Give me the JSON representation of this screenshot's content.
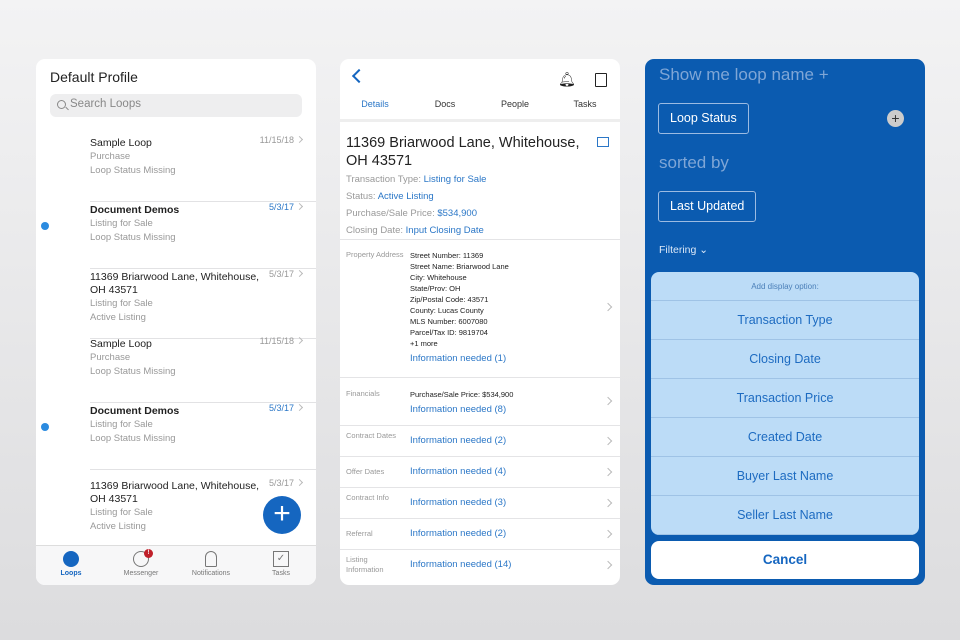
{
  "left": {
    "title": "Default Profile",
    "search_placeholder": "Search Loops",
    "loops": [
      {
        "title": "Sample Loop",
        "type": "Purchase",
        "status": "Loop Status Missing",
        "date": "11/15/18",
        "unread": false
      },
      {
        "title": "Document Demos",
        "type": "Listing for Sale",
        "status": "Loop Status Missing",
        "date": "5/3/17",
        "unread": true
      },
      {
        "title": "11369 Briarwood Lane, Whitehouse, OH 43571",
        "type": "Listing for Sale",
        "status": "Active Listing",
        "date": "5/3/17",
        "unread": false
      },
      {
        "title": "Sample Loop",
        "type": "Purchase",
        "status": "Loop Status Missing",
        "date": "11/15/18",
        "unread": false
      },
      {
        "title": "Document Demos",
        "type": "Listing for Sale",
        "status": "Loop Status Missing",
        "date": "5/3/17",
        "unread": true
      },
      {
        "title": "11369 Briarwood Lane, Whitehouse, OH 43571",
        "type": "Listing for Sale",
        "status": "Active Listing",
        "date": "5/3/17",
        "unread": false
      }
    ],
    "fab": "+",
    "tabs": [
      "Loops",
      "Messenger",
      "Notifications",
      "Tasks"
    ],
    "messenger_badge": "!"
  },
  "mid": {
    "tabs": [
      "Details",
      "Docs",
      "People",
      "Tasks"
    ],
    "address": "11369 Briarwood Lane, Whitehouse, OH 43571",
    "fields": [
      {
        "k": "Transaction Type: ",
        "v": "Listing for Sale"
      },
      {
        "k": "Status: ",
        "v": "Active Listing"
      },
      {
        "k": "Purchase/Sale Price: ",
        "v": "$534,900"
      },
      {
        "k": "Closing Date: ",
        "v": "Input Closing Date"
      }
    ],
    "property": {
      "label": "Property Address",
      "lines": [
        "Street Number: 11369",
        "Street Name: Briarwood Lane",
        "City: Whitehouse",
        "State/Prov: OH",
        "Zip/Postal Code: 43571",
        "County: Lucas County",
        "MLS Number: 6007080",
        "Parcel/Tax ID: 9819704",
        "+1 more"
      ],
      "info": "Information needed (1)"
    },
    "financials": {
      "label": "Financials",
      "line": "Purchase/Sale Price: $534,900",
      "info": "Information needed (8)"
    },
    "sections": [
      {
        "label": "Contract Dates",
        "info": "Information needed (2)"
      },
      {
        "label": "Offer Dates",
        "info": "Information needed (4)"
      },
      {
        "label": "Contract Info",
        "info": "Information needed (3)"
      },
      {
        "label": "Referral",
        "info": "Information needed (2)"
      },
      {
        "label": "Listing Information",
        "info": "Information needed (14)"
      }
    ]
  },
  "right": {
    "show_me": "Show me loop name +",
    "display_button": "Loop Status",
    "sorted_by": "sorted by",
    "sort_button": "Last Updated",
    "filtering": "Filtering",
    "sheet_header": "Add display option:",
    "options": [
      "Transaction Type",
      "Closing Date",
      "Transaction Price",
      "Created Date",
      "Buyer Last Name",
      "Seller Last Name"
    ],
    "cancel": "Cancel"
  }
}
